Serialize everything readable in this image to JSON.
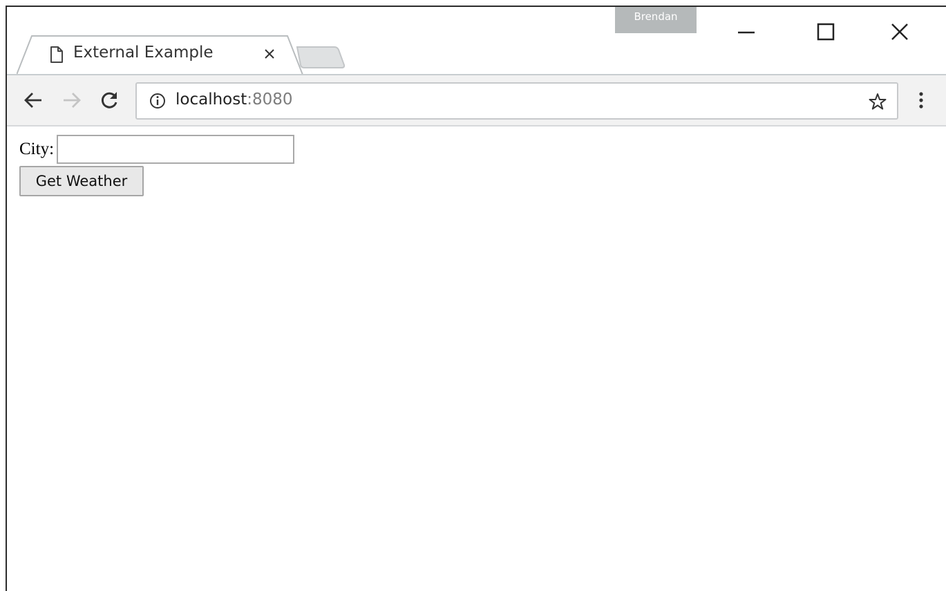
{
  "window": {
    "profile_name": "Brendan"
  },
  "tabs": [
    {
      "title": "External Example",
      "icon": "document-icon",
      "active": true
    }
  ],
  "toolbar": {
    "url_host": "localhost",
    "url_port": ":8080"
  },
  "page": {
    "city_label": "City:",
    "city_value": "",
    "city_placeholder": "",
    "button_label": "Get Weather"
  },
  "colors": {
    "profile_badge": "#b5b9ba",
    "toolbar_bg": "#f2f2f2",
    "url_port": "#7d7d7d"
  }
}
